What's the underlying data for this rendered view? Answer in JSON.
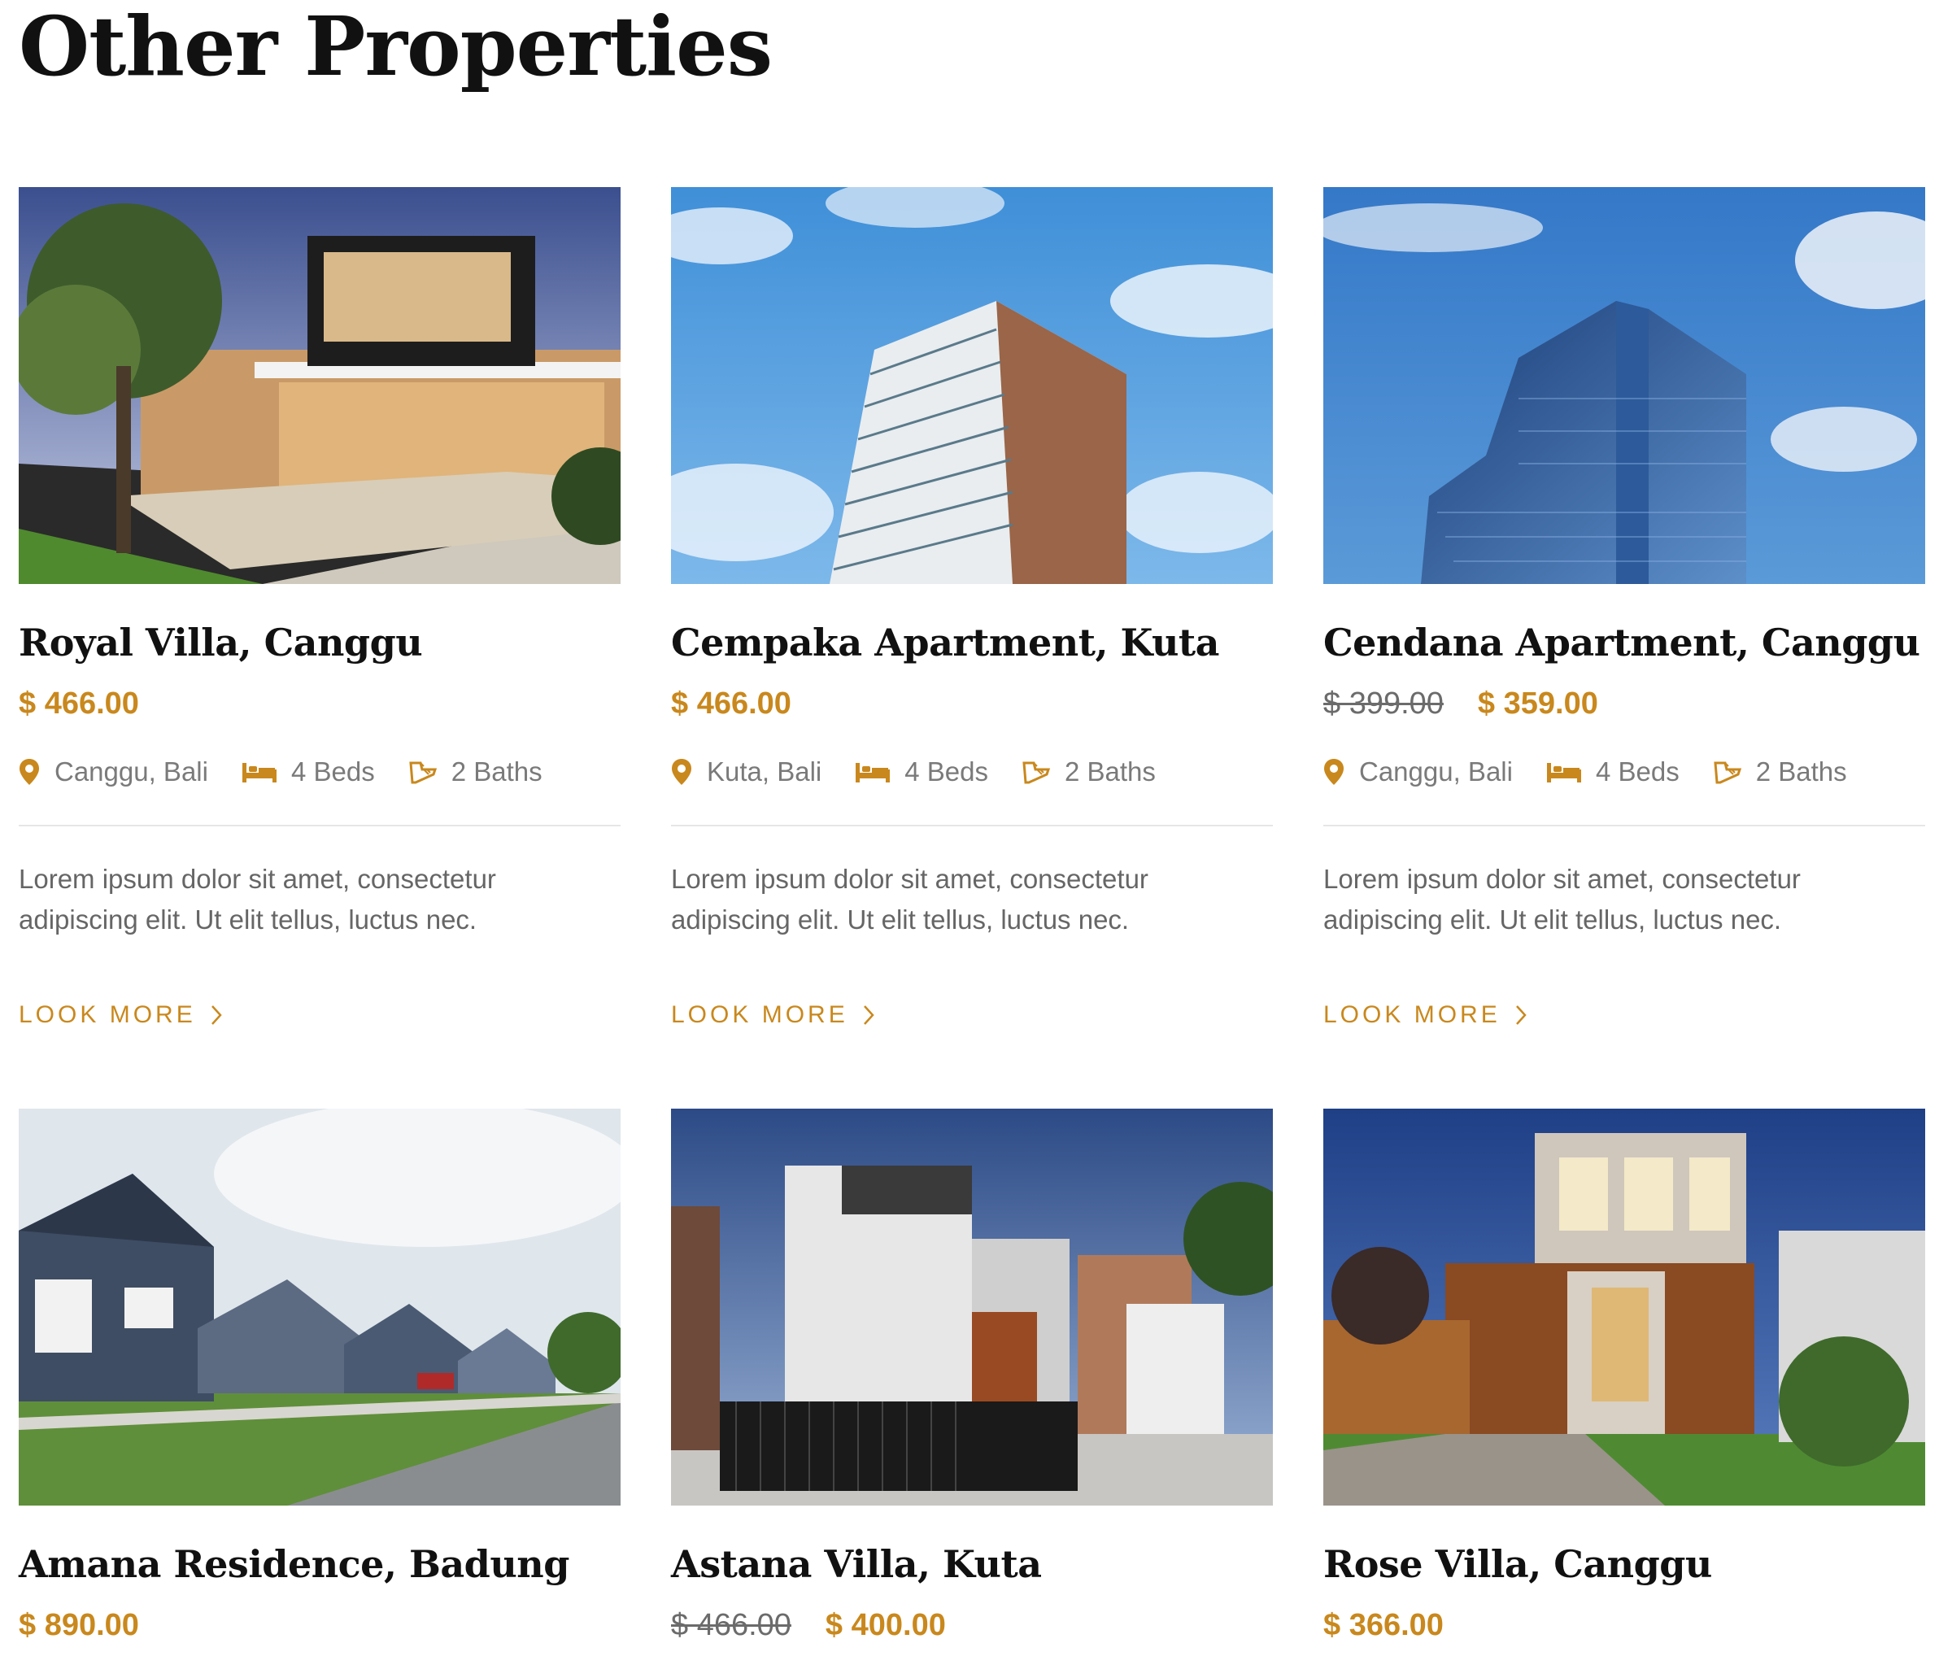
{
  "page": {
    "heading": "Other Properties"
  },
  "accent_color": "#c9881d",
  "cards": [
    {
      "title": "Royal Villa, Canggu",
      "old_price": "",
      "price": "$ 466.00",
      "location": "Canggu, Bali",
      "beds": "4 Beds",
      "baths": "2 Baths",
      "description": "Lorem ipsum dolor sit amet, consectetur adipiscing elit. Ut elit tellus, luctus nec.",
      "cta": "LOOK MORE"
    },
    {
      "title": "Cempaka Apartment, Kuta",
      "old_price": "",
      "price": "$ 466.00",
      "location": "Kuta, Bali",
      "beds": "4 Beds",
      "baths": "2 Baths",
      "description": "Lorem ipsum dolor sit amet, consectetur adipiscing elit. Ut elit tellus, luctus nec.",
      "cta": "LOOK MORE"
    },
    {
      "title": "Cendana Apartment, Canggu",
      "old_price": "$ 399.00",
      "price": "$ 359.00",
      "location": "Canggu, Bali",
      "beds": "4 Beds",
      "baths": "2 Baths",
      "description": "Lorem ipsum dolor sit amet, consectetur adipiscing elit. Ut elit tellus, luctus nec.",
      "cta": "LOOK MORE"
    },
    {
      "title": "Amana Residence, Badung",
      "old_price": "",
      "price": "$ 890.00"
    },
    {
      "title": "Astana Villa, Kuta",
      "old_price": "$ 466.00",
      "price": "$ 400.00"
    },
    {
      "title": "Rose Villa, Canggu",
      "old_price": "",
      "price": "$ 366.00"
    }
  ]
}
